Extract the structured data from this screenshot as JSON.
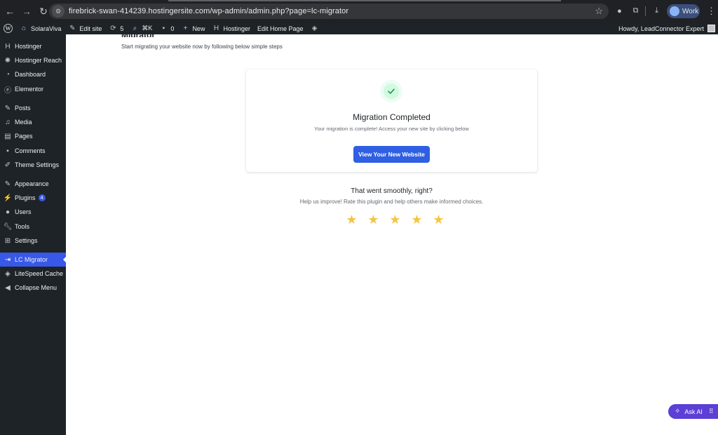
{
  "browser": {
    "url": "firebrick-swan-414239.hostingersite.com/wp-admin/admin.php?page=lc-migrator",
    "profile_label": "Work"
  },
  "admin_bar": {
    "site_name": "SolaraViva",
    "edit_site": "Edit site",
    "updates_count": "5",
    "search_shortcut": "⌘K",
    "comments_count": "0",
    "new_label": "New",
    "hostinger_label": "Hostinger",
    "edit_home": "Edit Home Page",
    "howdy": "Howdy, LeadConnector Expert"
  },
  "sidebar": {
    "items": [
      {
        "label": "Hostinger",
        "icon": "hostinger-icon"
      },
      {
        "label": "Hostinger Reach",
        "icon": "reach-icon"
      },
      {
        "label": "Dashboard",
        "icon": "dashboard-icon"
      },
      {
        "label": "Elementor",
        "icon": "elementor-icon"
      },
      {
        "label": "Posts",
        "icon": "pin-icon"
      },
      {
        "label": "Media",
        "icon": "media-icon"
      },
      {
        "label": "Pages",
        "icon": "pages-icon"
      },
      {
        "label": "Comments",
        "icon": "comment-icon"
      },
      {
        "label": "Theme Settings",
        "icon": "brush-icon"
      },
      {
        "label": "Appearance",
        "icon": "appearance-icon"
      },
      {
        "label": "Plugins",
        "icon": "plugin-icon",
        "badge": "4"
      },
      {
        "label": "Users",
        "icon": "user-icon"
      },
      {
        "label": "Tools",
        "icon": "wrench-icon"
      },
      {
        "label": "Settings",
        "icon": "settings-icon"
      },
      {
        "label": "LC Migrator",
        "icon": "migrate-icon",
        "active": true
      },
      {
        "label": "LiteSpeed Cache",
        "icon": "litespeed-icon"
      },
      {
        "label": "Collapse Menu",
        "icon": "collapse-icon"
      }
    ]
  },
  "main": {
    "title": "Migrator",
    "subtitle": "Start migrating your website now by following below simple steps",
    "card": {
      "title": "Migration Completed",
      "subtitle": "Your migration is complete! Access your new site by clicking below",
      "button": "View Your New Website"
    },
    "rating": {
      "title": "That went smoothly, right?",
      "subtitle": "Help us improve! Rate this plugin and help others make informed choices.",
      "stars": 5
    }
  },
  "ask_ai": {
    "label": "Ask AI"
  },
  "colors": {
    "accent": "#2f5fe3",
    "active_menu": "#3858e9",
    "star": "#f4c542",
    "success": "#12b76a"
  }
}
